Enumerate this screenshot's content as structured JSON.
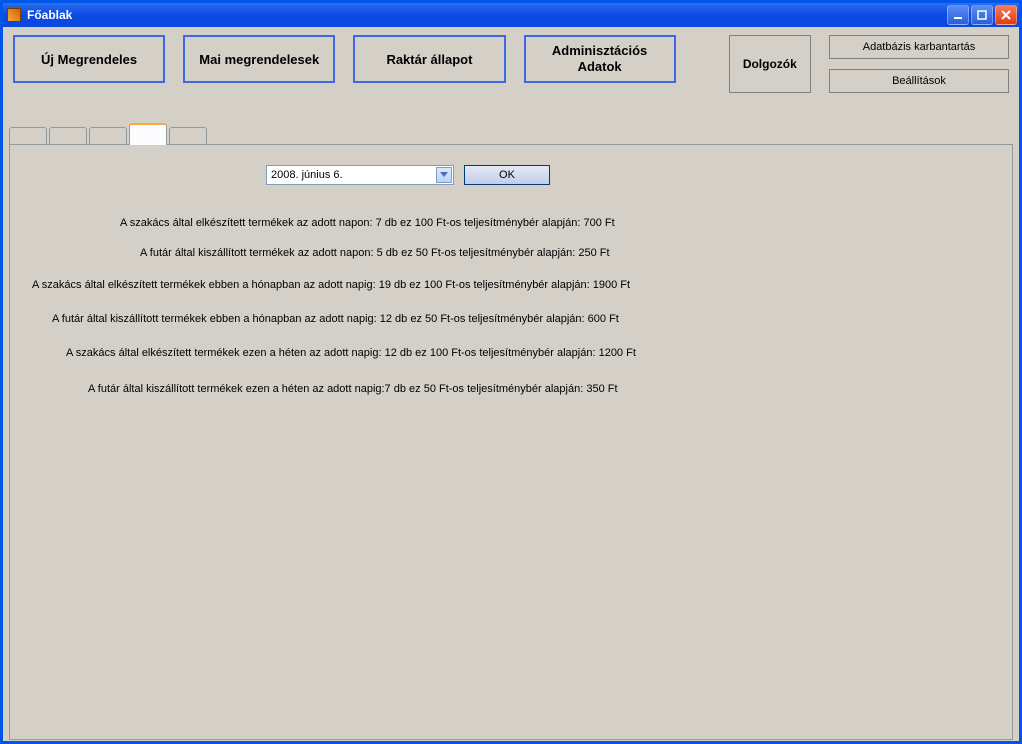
{
  "window": {
    "title": "Főablak"
  },
  "toolbar": {
    "new_order": "Új Megrendeles",
    "todays_orders": "Mai megrendelesek",
    "warehouse_status": "Raktár állapot",
    "admin_data_line1": "Adminisztációs",
    "admin_data_line2": "Adatok",
    "employees": "Dolgozók",
    "db_maintenance": "Adatbázis karbantartás",
    "settings": "Beállítások"
  },
  "date_picker": {
    "value": "2008.    június      6.",
    "ok": "OK"
  },
  "report": {
    "line1": "A szakács által elkészített termékek az adott napon: 7 db ez 100 Ft-os teljesítménybér alapján: 700 Ft",
    "line2": "A futár által kiszállított termékek az adott napon: 5 db ez 50 Ft-os teljesítménybér alapján: 250 Ft",
    "line3": "A szakács által elkészített termékek ebben a hónapban az adott napig: 19 db ez 100 Ft-os teljesítménybér alapján: 1900 Ft",
    "line4": "A futár által kiszállított termékek ebben a hónapban az adott napig: 12 db ez 50 Ft-os teljesítménybér alapján: 600 Ft",
    "line5": "A szakács által elkészített termékek ezen a héten az adott napig: 12 db  ez 100 Ft-os teljesítménybér alapján: 1200 Ft",
    "line6": "A futár által kiszállított termékek ezen a héten az adott napig:7 db ez 50 Ft-os teljesítménybér alapján: 350 Ft"
  }
}
